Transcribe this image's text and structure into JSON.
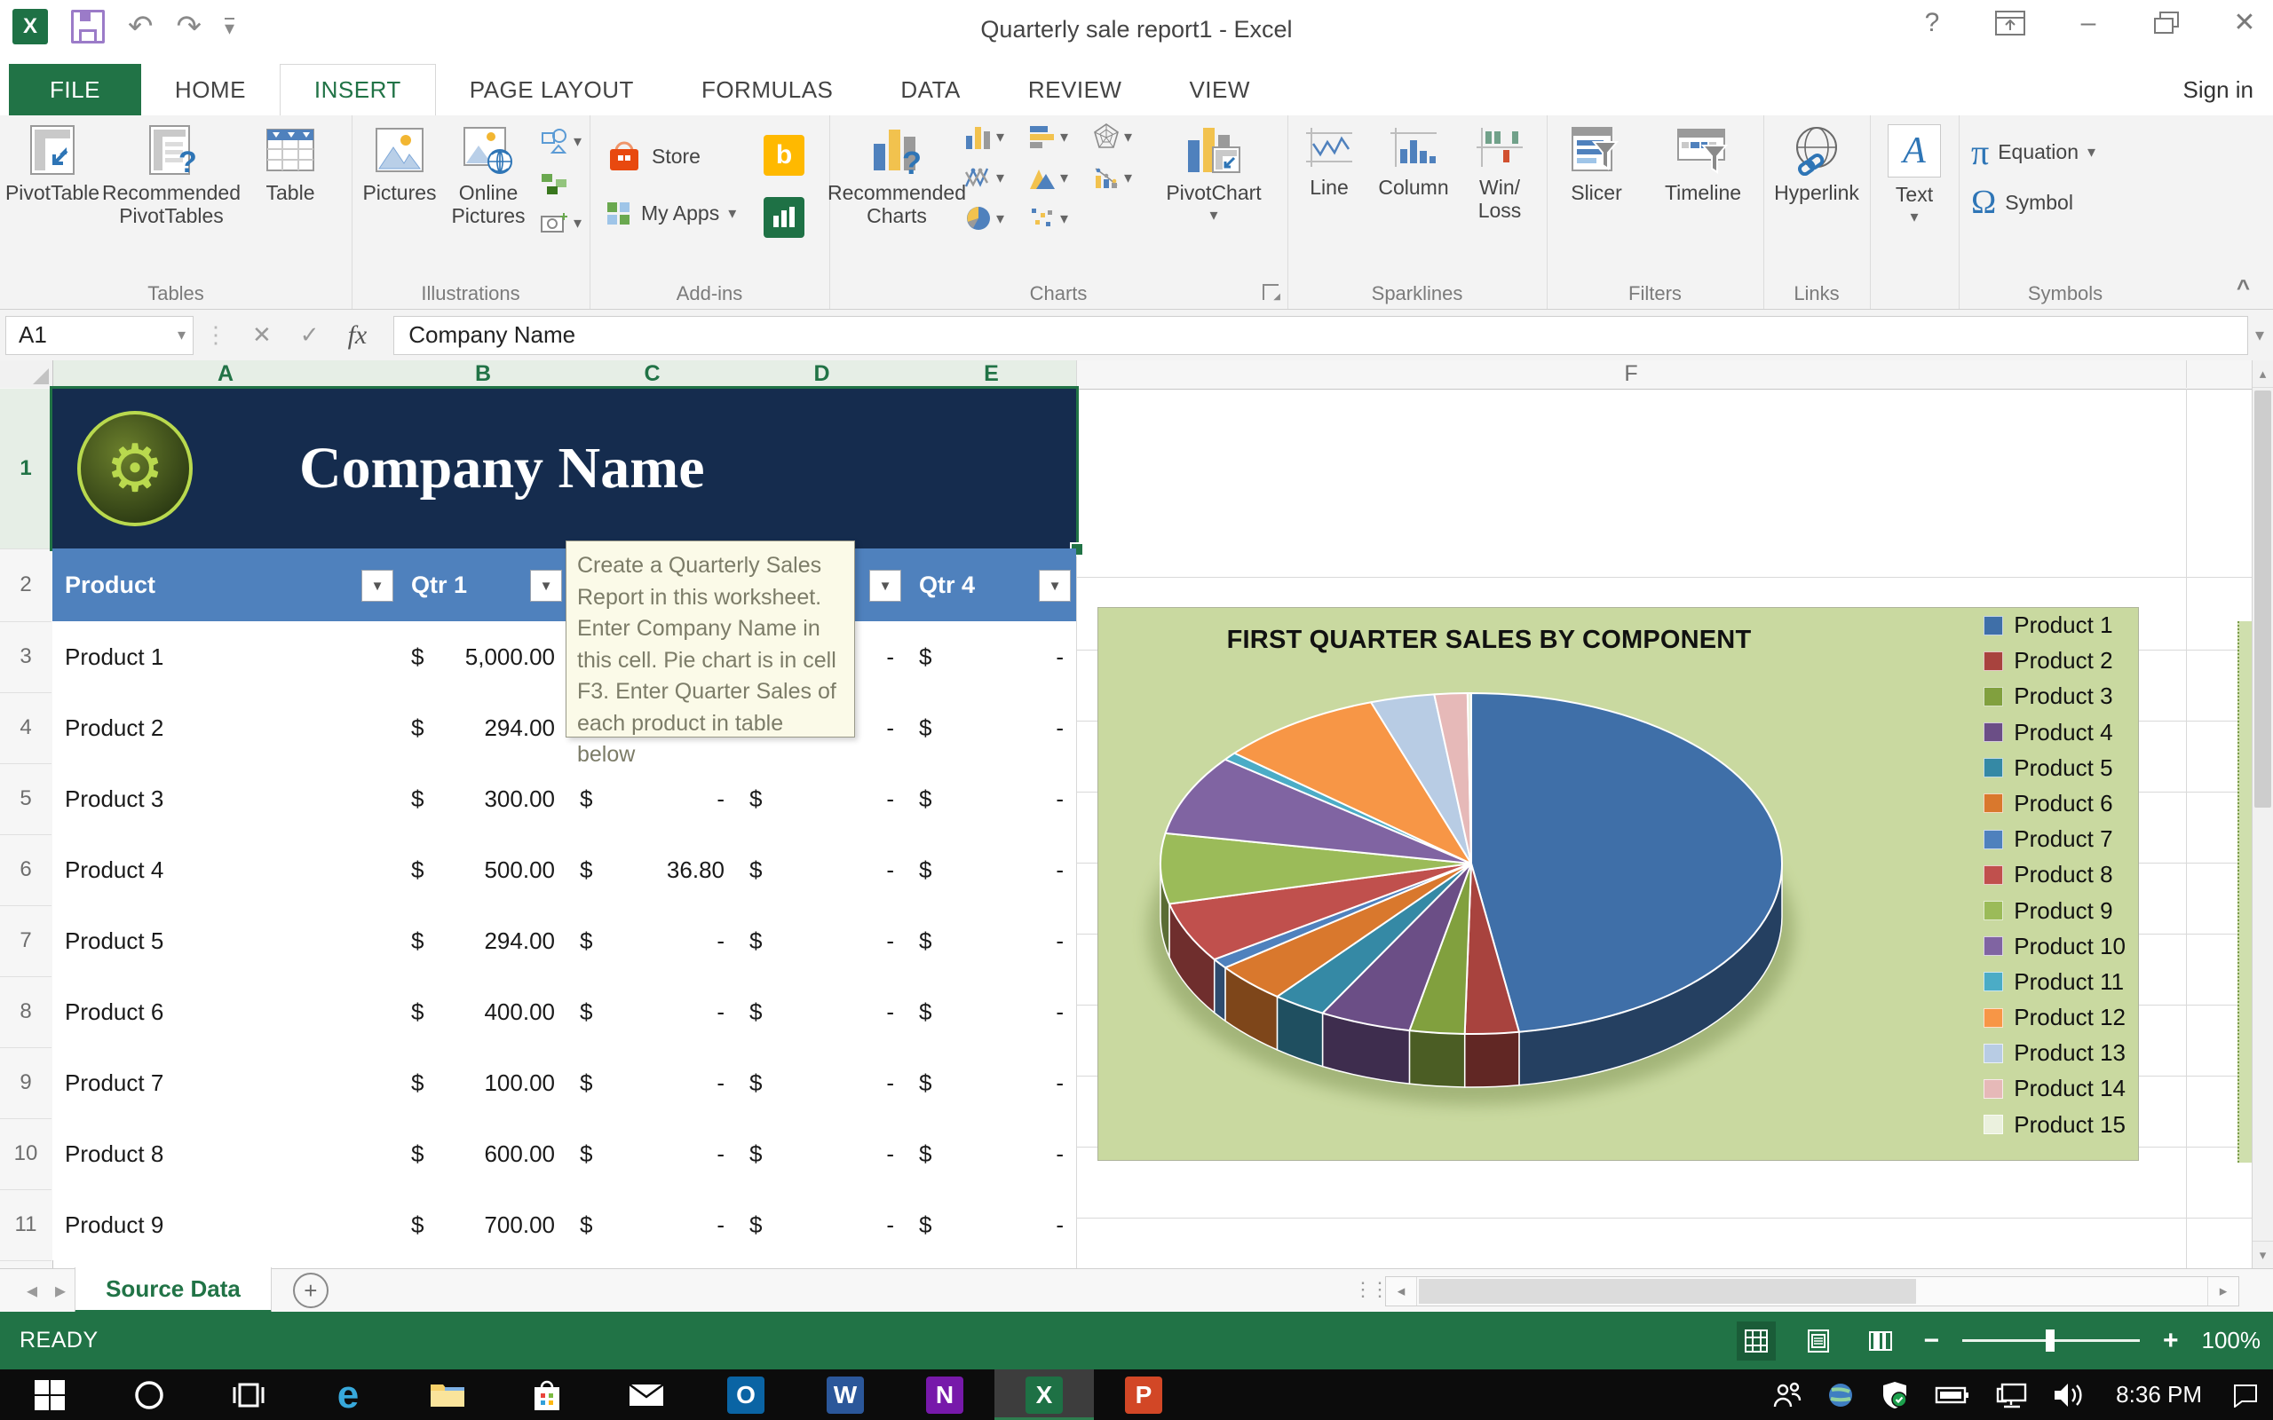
{
  "colors": {
    "excel_green": "#217346",
    "table_header_blue": "#4f81bd",
    "banner_navy": "#152c4e",
    "chart_bg": "#c9d9a0",
    "tooltip_bg": "#fbfae8",
    "taskbar_bg": "#0c0c0c"
  },
  "glyphs": {
    "undo": "↶",
    "redo": "↷",
    "dropdown": "▾",
    "cancel": "✕",
    "enter": "✓",
    "fx": "fx",
    "help": "?",
    "minimize": "–",
    "close": "✕",
    "filter": "▼",
    "nav_left": "◂",
    "nav_right": "▸",
    "scroll_up": "▴",
    "scroll_down": "▾",
    "plus": "+",
    "zoom_minus": "−",
    "zoom_plus": "+",
    "chevron_up": "^",
    "drag_dots": "⋮⋮",
    "pi": "π",
    "omega": "Ω",
    "text_a": "A",
    "gear": "⚙",
    "excel_x": "X"
  },
  "title_bar": {
    "title": "Quarterly sale report1 - Excel",
    "controls": [
      "help",
      "ribbon-display-options",
      "minimize",
      "restore-down",
      "close"
    ]
  },
  "quick_access": {
    "buttons": [
      "excel-logo",
      "save",
      "undo",
      "redo",
      "customize-quick-access"
    ]
  },
  "tabs": {
    "items": [
      "FILE",
      "HOME",
      "INSERT",
      "PAGE LAYOUT",
      "FORMULAS",
      "DATA",
      "REVIEW",
      "VIEW"
    ],
    "active": "INSERT",
    "sign_in": "Sign in"
  },
  "ribbon": {
    "group_labels": [
      "Tables",
      "Illustrations",
      "Add-ins",
      "Charts",
      "Sparklines",
      "Filters",
      "Links",
      "Symbols"
    ],
    "buttons": {
      "pivottable": "PivotTable",
      "recommended_pivottables": "Recommended PivotTables",
      "table": "Table",
      "pictures": "Pictures",
      "online_pictures": "Online Pictures",
      "store": "Store",
      "my_apps": "My Apps",
      "recommended_charts": "Recommended Charts",
      "pivotchart": "PivotChart",
      "spark_line": "Line",
      "spark_column": "Column",
      "win_loss_1": "Win/",
      "win_loss_2": "Loss",
      "slicer": "Slicer",
      "timeline": "Timeline",
      "hyperlink": "Hyperlink",
      "text": "Text",
      "equation": "Equation",
      "symbol": "Symbol"
    },
    "chart_buttons": [
      "insert-column-chart",
      "insert-bar-chart",
      "insert-radar-chart",
      "insert-line-chart",
      "insert-area-chart",
      "insert-stock-chart",
      "insert-pie-chart",
      "insert-scatter-chart"
    ]
  },
  "formula_bar": {
    "name_box": "A1",
    "formula": "Company Name"
  },
  "sheet": {
    "column_headers": [
      "A",
      "B",
      "C",
      "D",
      "E",
      "F"
    ],
    "selected_columns": [
      "A",
      "B",
      "C",
      "D",
      "E"
    ],
    "row_numbers": [
      "1",
      "2",
      "3",
      "4",
      "5",
      "6",
      "7",
      "8",
      "9",
      "10",
      "11"
    ],
    "banner": {
      "title": "Company Name",
      "logo": "gear-logo"
    },
    "header_row": {
      "cells": [
        {
          "label": "Product",
          "filter": true
        },
        {
          "label": "Qtr 1",
          "filter": true
        },
        {
          "label": "",
          "filter": false
        },
        {
          "label": "",
          "filter": true
        },
        {
          "label": "Qtr 4",
          "filter": true
        }
      ]
    },
    "rows": [
      {
        "num": "3",
        "product": "Product 1",
        "b_cur": "$",
        "b": "5,000.00",
        "c_cur": "",
        "c": "",
        "d_cur": "",
        "d": "-",
        "e_cur": "$",
        "e": "-"
      },
      {
        "num": "4",
        "product": "Product 2",
        "b_cur": "$",
        "b": "294.00",
        "c_cur": "",
        "c": "",
        "d_cur": "",
        "d": "-",
        "e_cur": "$",
        "e": "-"
      },
      {
        "num": "5",
        "product": "Product 3",
        "b_cur": "$",
        "b": "300.00",
        "c_cur": "$",
        "c": "-",
        "d_cur": "$",
        "d": "-",
        "e_cur": "$",
        "e": "-"
      },
      {
        "num": "6",
        "product": "Product 4",
        "b_cur": "$",
        "b": "500.00",
        "c_cur": "$",
        "c": "36.80",
        "d_cur": "$",
        "d": "-",
        "e_cur": "$",
        "e": "-"
      },
      {
        "num": "7",
        "product": "Product 5",
        "b_cur": "$",
        "b": "294.00",
        "c_cur": "$",
        "c": "-",
        "d_cur": "$",
        "d": "-",
        "e_cur": "$",
        "e": "-"
      },
      {
        "num": "8",
        "product": "Product 6",
        "b_cur": "$",
        "b": "400.00",
        "c_cur": "$",
        "c": "-",
        "d_cur": "$",
        "d": "-",
        "e_cur": "$",
        "e": "-"
      },
      {
        "num": "9",
        "product": "Product 7",
        "b_cur": "$",
        "b": "100.00",
        "c_cur": "$",
        "c": "-",
        "d_cur": "$",
        "d": "-",
        "e_cur": "$",
        "e": "-"
      },
      {
        "num": "10",
        "product": "Product 8",
        "b_cur": "$",
        "b": "600.00",
        "c_cur": "$",
        "c": "-",
        "d_cur": "$",
        "d": "-",
        "e_cur": "$",
        "e": "-"
      },
      {
        "num": "11",
        "product": "Product 9",
        "b_cur": "$",
        "b": "700.00",
        "c_cur": "$",
        "c": "-",
        "d_cur": "$",
        "d": "-",
        "e_cur": "$",
        "e": "-"
      }
    ],
    "tooltip": "Create a Quarterly Sales Report in this worksheet. Enter Company Name in this cell. Pie chart is in cell F3. Enter Quarter Sales of each product in table below",
    "tab_name": "Source Data"
  },
  "chart_data": {
    "type": "pie",
    "effect": "3d",
    "title": "FIRST QUARTER SALES BY COMPONENT",
    "legend_position": "right",
    "labels": [
      "Product 1",
      "Product 2",
      "Product 3",
      "Product 4",
      "Product 5",
      "Product 6",
      "Product 7",
      "Product 8",
      "Product 9",
      "Product 10",
      "Product 11",
      "Product 12",
      "Product 13",
      "Product 14",
      "Product 15"
    ],
    "values": [
      5000,
      294,
      300,
      500,
      294,
      400,
      100,
      600,
      700,
      800,
      80,
      900,
      350,
      180,
      20
    ],
    "values_note": "Products 1-9 from worksheet Qtr 1 column; Products 10-15 estimated from slice angles",
    "colors": [
      "#3f6fa8",
      "#a8433e",
      "#81a03e",
      "#6b4e86",
      "#3589a5",
      "#d9782d",
      "#4f81bd",
      "#c0504d",
      "#9bbb59",
      "#8064a2",
      "#4bacc6",
      "#f79646",
      "#b8cce4",
      "#e6b9b8",
      "#ebf1de"
    ]
  },
  "status_bar": {
    "mode": "READY",
    "zoom_level": "100%",
    "view_buttons": [
      "normal-view",
      "page-layout-view",
      "page-break-preview"
    ]
  },
  "taskbar": {
    "apps": [
      "start",
      "cortana",
      "task-view",
      "edge",
      "file-explorer",
      "store",
      "mail",
      "outlook",
      "word",
      "onenote",
      "excel",
      "powerpoint"
    ],
    "active_app": "excel",
    "tray": [
      "people",
      "network-globe",
      "defender",
      "battery",
      "network",
      "volume"
    ],
    "time": "8:36 PM"
  }
}
